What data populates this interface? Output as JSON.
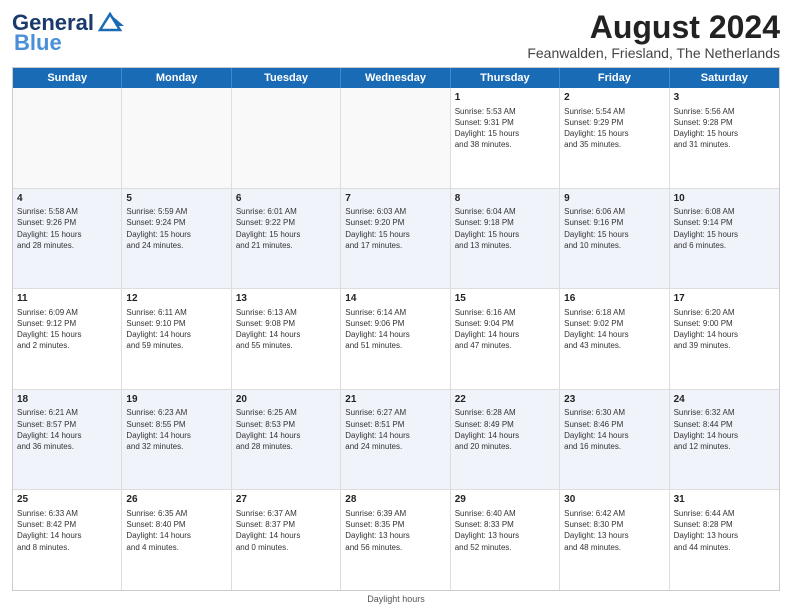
{
  "header": {
    "logo_line1": "General",
    "logo_line2": "Blue",
    "title": "August 2024",
    "subtitle": "Feanwalden, Friesland, The Netherlands"
  },
  "weekdays": [
    "Sunday",
    "Monday",
    "Tuesday",
    "Wednesday",
    "Thursday",
    "Friday",
    "Saturday"
  ],
  "rows": [
    {
      "alt": false,
      "cells": [
        {
          "day": "",
          "info": ""
        },
        {
          "day": "",
          "info": ""
        },
        {
          "day": "",
          "info": ""
        },
        {
          "day": "",
          "info": ""
        },
        {
          "day": "1",
          "info": "Sunrise: 5:53 AM\nSunset: 9:31 PM\nDaylight: 15 hours\nand 38 minutes."
        },
        {
          "day": "2",
          "info": "Sunrise: 5:54 AM\nSunset: 9:29 PM\nDaylight: 15 hours\nand 35 minutes."
        },
        {
          "day": "3",
          "info": "Sunrise: 5:56 AM\nSunset: 9:28 PM\nDaylight: 15 hours\nand 31 minutes."
        }
      ]
    },
    {
      "alt": true,
      "cells": [
        {
          "day": "4",
          "info": "Sunrise: 5:58 AM\nSunset: 9:26 PM\nDaylight: 15 hours\nand 28 minutes."
        },
        {
          "day": "5",
          "info": "Sunrise: 5:59 AM\nSunset: 9:24 PM\nDaylight: 15 hours\nand 24 minutes."
        },
        {
          "day": "6",
          "info": "Sunrise: 6:01 AM\nSunset: 9:22 PM\nDaylight: 15 hours\nand 21 minutes."
        },
        {
          "day": "7",
          "info": "Sunrise: 6:03 AM\nSunset: 9:20 PM\nDaylight: 15 hours\nand 17 minutes."
        },
        {
          "day": "8",
          "info": "Sunrise: 6:04 AM\nSunset: 9:18 PM\nDaylight: 15 hours\nand 13 minutes."
        },
        {
          "day": "9",
          "info": "Sunrise: 6:06 AM\nSunset: 9:16 PM\nDaylight: 15 hours\nand 10 minutes."
        },
        {
          "day": "10",
          "info": "Sunrise: 6:08 AM\nSunset: 9:14 PM\nDaylight: 15 hours\nand 6 minutes."
        }
      ]
    },
    {
      "alt": false,
      "cells": [
        {
          "day": "11",
          "info": "Sunrise: 6:09 AM\nSunset: 9:12 PM\nDaylight: 15 hours\nand 2 minutes."
        },
        {
          "day": "12",
          "info": "Sunrise: 6:11 AM\nSunset: 9:10 PM\nDaylight: 14 hours\nand 59 minutes."
        },
        {
          "day": "13",
          "info": "Sunrise: 6:13 AM\nSunset: 9:08 PM\nDaylight: 14 hours\nand 55 minutes."
        },
        {
          "day": "14",
          "info": "Sunrise: 6:14 AM\nSunset: 9:06 PM\nDaylight: 14 hours\nand 51 minutes."
        },
        {
          "day": "15",
          "info": "Sunrise: 6:16 AM\nSunset: 9:04 PM\nDaylight: 14 hours\nand 47 minutes."
        },
        {
          "day": "16",
          "info": "Sunrise: 6:18 AM\nSunset: 9:02 PM\nDaylight: 14 hours\nand 43 minutes."
        },
        {
          "day": "17",
          "info": "Sunrise: 6:20 AM\nSunset: 9:00 PM\nDaylight: 14 hours\nand 39 minutes."
        }
      ]
    },
    {
      "alt": true,
      "cells": [
        {
          "day": "18",
          "info": "Sunrise: 6:21 AM\nSunset: 8:57 PM\nDaylight: 14 hours\nand 36 minutes."
        },
        {
          "day": "19",
          "info": "Sunrise: 6:23 AM\nSunset: 8:55 PM\nDaylight: 14 hours\nand 32 minutes."
        },
        {
          "day": "20",
          "info": "Sunrise: 6:25 AM\nSunset: 8:53 PM\nDaylight: 14 hours\nand 28 minutes."
        },
        {
          "day": "21",
          "info": "Sunrise: 6:27 AM\nSunset: 8:51 PM\nDaylight: 14 hours\nand 24 minutes."
        },
        {
          "day": "22",
          "info": "Sunrise: 6:28 AM\nSunset: 8:49 PM\nDaylight: 14 hours\nand 20 minutes."
        },
        {
          "day": "23",
          "info": "Sunrise: 6:30 AM\nSunset: 8:46 PM\nDaylight: 14 hours\nand 16 minutes."
        },
        {
          "day": "24",
          "info": "Sunrise: 6:32 AM\nSunset: 8:44 PM\nDaylight: 14 hours\nand 12 minutes."
        }
      ]
    },
    {
      "alt": false,
      "cells": [
        {
          "day": "25",
          "info": "Sunrise: 6:33 AM\nSunset: 8:42 PM\nDaylight: 14 hours\nand 8 minutes."
        },
        {
          "day": "26",
          "info": "Sunrise: 6:35 AM\nSunset: 8:40 PM\nDaylight: 14 hours\nand 4 minutes."
        },
        {
          "day": "27",
          "info": "Sunrise: 6:37 AM\nSunset: 8:37 PM\nDaylight: 14 hours\nand 0 minutes."
        },
        {
          "day": "28",
          "info": "Sunrise: 6:39 AM\nSunset: 8:35 PM\nDaylight: 13 hours\nand 56 minutes."
        },
        {
          "day": "29",
          "info": "Sunrise: 6:40 AM\nSunset: 8:33 PM\nDaylight: 13 hours\nand 52 minutes."
        },
        {
          "day": "30",
          "info": "Sunrise: 6:42 AM\nSunset: 8:30 PM\nDaylight: 13 hours\nand 48 minutes."
        },
        {
          "day": "31",
          "info": "Sunrise: 6:44 AM\nSunset: 8:28 PM\nDaylight: 13 hours\nand 44 minutes."
        }
      ]
    }
  ],
  "footer": "Daylight hours"
}
